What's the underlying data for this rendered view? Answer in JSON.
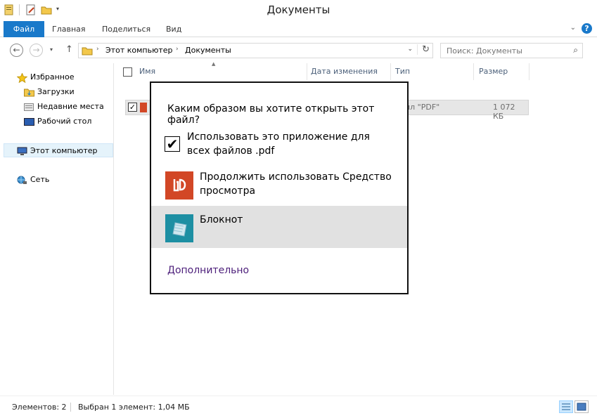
{
  "window": {
    "title": "Документы"
  },
  "ribbon": {
    "tabs": [
      {
        "label": "Файл",
        "active": true
      },
      {
        "label": "Главная"
      },
      {
        "label": "Поделиться"
      },
      {
        "label": "Вид"
      }
    ],
    "help_glyph": "?"
  },
  "address_bar": {
    "segments": [
      "Этот компьютер",
      "Документы"
    ],
    "search_placeholder": "Поиск: Документы"
  },
  "nav_pane": {
    "favorites_label": "Избранное",
    "favorites": [
      "Загрузки",
      "Недавние места",
      "Рабочий стол"
    ],
    "this_pc": "Этот компьютер",
    "network": "Сеть"
  },
  "file_list": {
    "columns": [
      "Имя",
      "Дата изменения",
      "Тип",
      "Размер"
    ],
    "rows": [
      {
        "type": "йл \"PDF\"",
        "size": "1 072 КБ",
        "checked": true
      }
    ]
  },
  "status_bar": {
    "items_count": "Элементов: 2",
    "selection": "Выбран 1 элемент: 1,04 МБ"
  },
  "dialog": {
    "question": "Каким образом вы хотите открыть этот файл?",
    "remember_label": "Использовать это приложение для всех файлов .pdf",
    "remember_checked": true,
    "apps": [
      {
        "name": "Продолжить использовать Средство просмотра",
        "icon": "pdf-reader-icon",
        "color": "#d24726"
      },
      {
        "name": "Блокнот",
        "icon": "notepad-icon",
        "color": "#1d8fa3",
        "selected": true
      }
    ],
    "more_link": "Дополнительно"
  },
  "colors": {
    "accent": "#1979ca",
    "link": "#4c1e7a",
    "selected_row": "#e1e1e1"
  }
}
